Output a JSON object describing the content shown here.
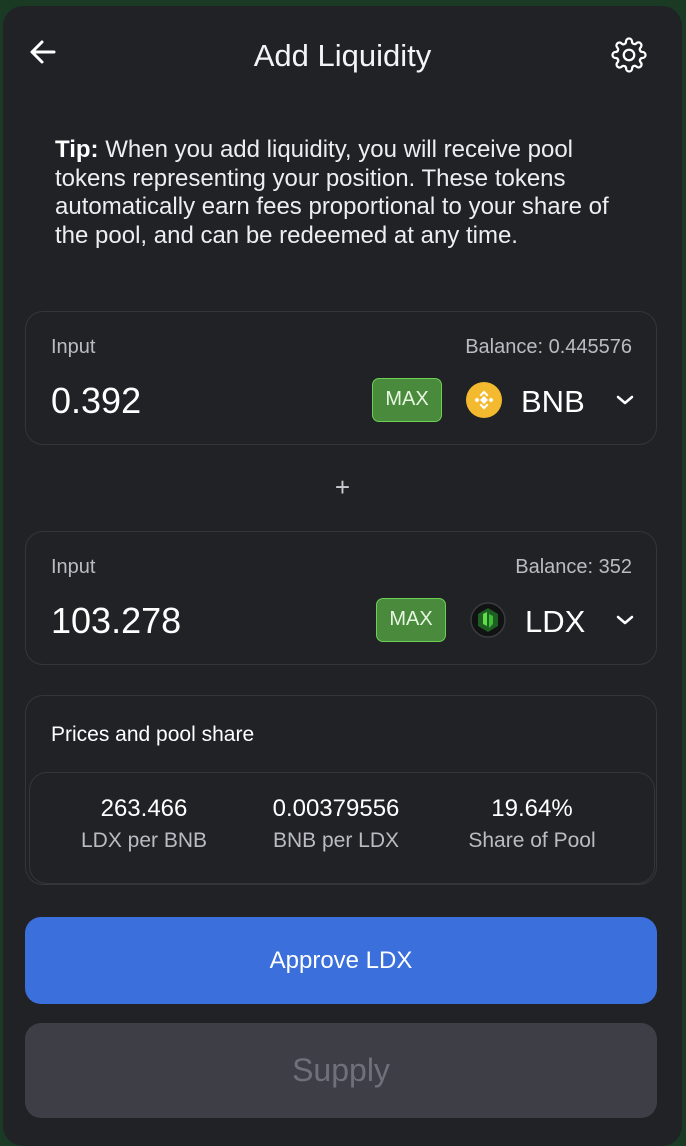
{
  "header": {
    "title": "Add Liquidity",
    "back_icon": "arrow-left-icon",
    "settings_icon": "gear-icon"
  },
  "tip": {
    "label": "Tip:",
    "text": " When you add liquidity, you will receive pool tokens representing your position. These tokens automatically earn fees proportional to your share of the pool, and can be redeemed at any time."
  },
  "inputs": [
    {
      "label": "Input",
      "balance": "Balance: 0.445576",
      "amount": "0.392",
      "max_label": "MAX",
      "token": "BNB",
      "token_icon": "bnb-token-icon",
      "token_color": "#F3BA2F"
    },
    {
      "label": "Input",
      "balance": "Balance: 352",
      "amount": "103.278",
      "max_label": "MAX",
      "token": "LDX",
      "token_icon": "ldx-token-icon",
      "token_color": "#3DBE3A"
    }
  ],
  "plus": "+",
  "prices": {
    "title": "Prices and pool share",
    "items": [
      {
        "value": "263.466",
        "label": "LDX per BNB"
      },
      {
        "value": "0.00379556",
        "label": "BNB per LDX"
      },
      {
        "value": "19.64%",
        "label": "Share of Pool"
      }
    ]
  },
  "actions": {
    "approve_label": "Approve LDX",
    "supply_label": "Supply"
  },
  "colors": {
    "background": "#212226",
    "accent_blue": "#3A6FDC",
    "max_green": "#4A8A3C",
    "disabled": "#3D3E46"
  }
}
